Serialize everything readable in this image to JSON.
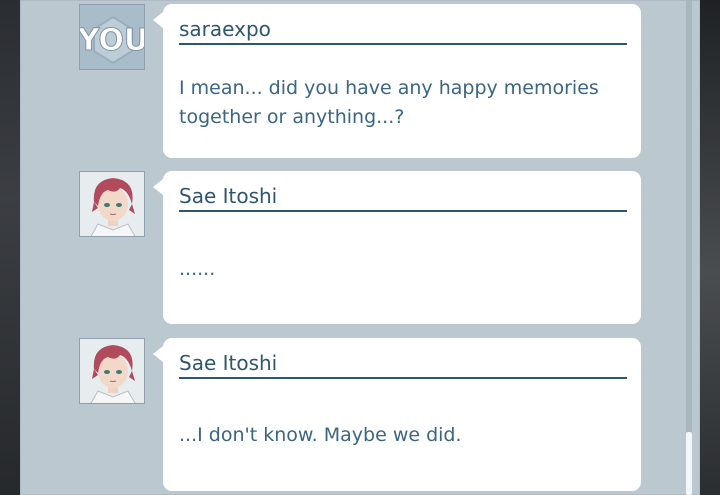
{
  "chat_log": [
    {
      "speaker": "saraexpo",
      "avatar_text": "YOU",
      "avatar_type": "you",
      "message": "I mean... did you have any happy memories together or anything...?"
    },
    {
      "speaker": "Sae Itoshi",
      "avatar_type": "character",
      "message": "......"
    },
    {
      "speaker": "Sae Itoshi",
      "avatar_type": "character",
      "message": "...I don't know. Maybe we did."
    }
  ],
  "colors": {
    "panel": "#bcc8d0",
    "name_text": "#2e5670",
    "message_text": "#3a6583",
    "hair": "#b04a5c"
  }
}
